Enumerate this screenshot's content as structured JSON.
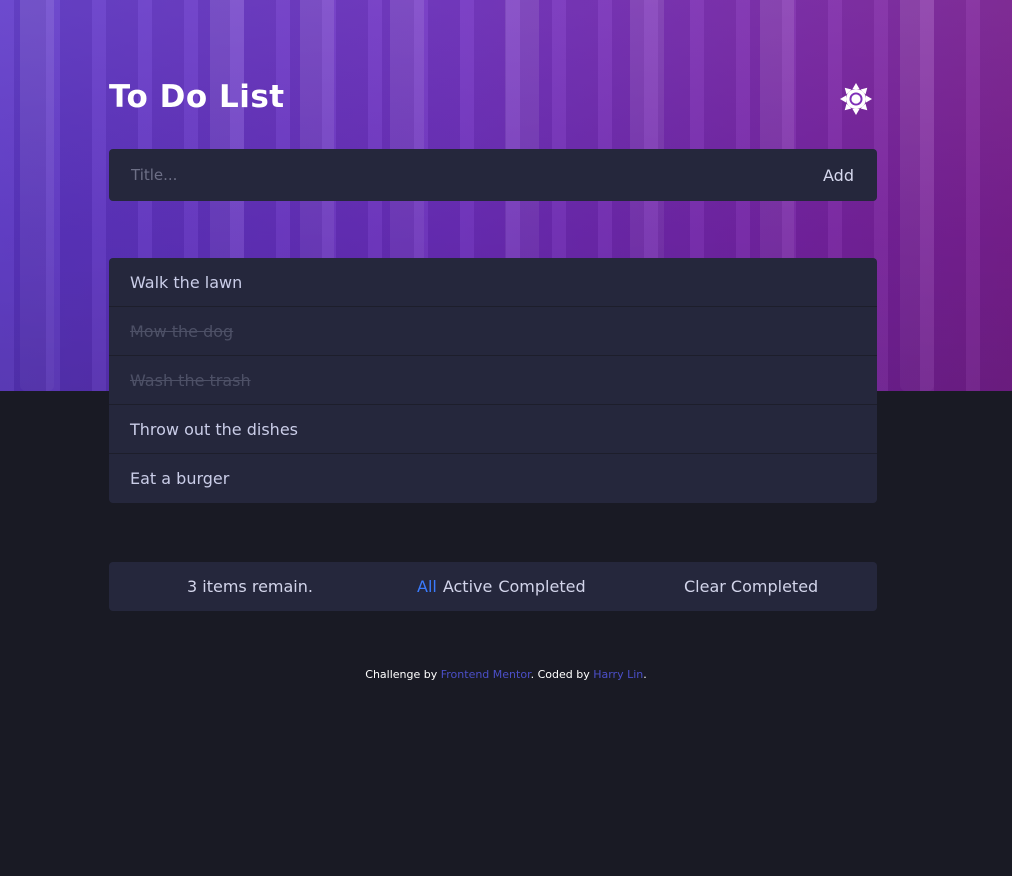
{
  "header": {
    "title": "To Do List",
    "theme_icon": "sun-icon"
  },
  "add_form": {
    "placeholder": "Title...",
    "value": "",
    "add_label": "Add"
  },
  "todos": [
    {
      "text": "Walk the lawn",
      "completed": false
    },
    {
      "text": "Mow the dog",
      "completed": true
    },
    {
      "text": "Wash the trash",
      "completed": true
    },
    {
      "text": "Throw out the dishes",
      "completed": false
    },
    {
      "text": "Eat a burger",
      "completed": false
    }
  ],
  "footer": {
    "remaining": "3 items remain.",
    "filters": [
      {
        "label": "All",
        "active": true
      },
      {
        "label": "Active",
        "active": false
      },
      {
        "label": "Completed",
        "active": false
      }
    ],
    "clear_label": "Clear Completed"
  },
  "attribution": {
    "prefix": "Challenge by ",
    "link1": "Frontend Mentor",
    "middle": ". Coded by ",
    "link2": "Harry Lin",
    "suffix": "."
  },
  "colors": {
    "background": "#191a24",
    "card": "#25273c",
    "accent": "#3a7bfd",
    "link": "#4b4fc8",
    "hero_left": "#5d37c9",
    "hero_right": "#7e2196"
  }
}
